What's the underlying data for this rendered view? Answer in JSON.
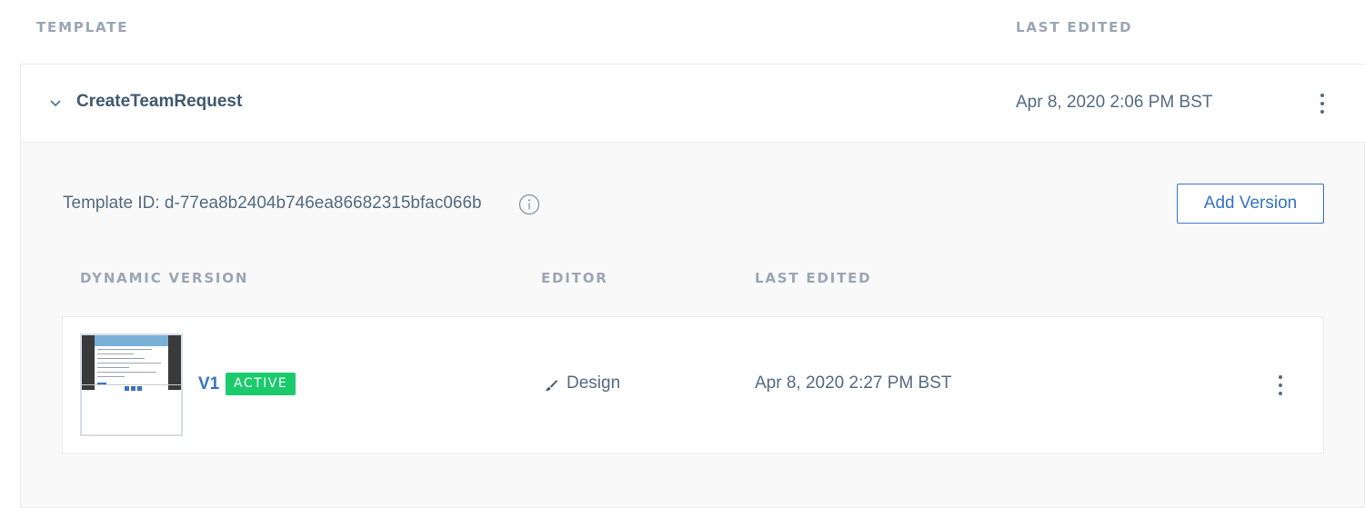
{
  "table_header": {
    "template": "TEMPLATE",
    "last_edited": "LAST EDITED"
  },
  "template": {
    "name": "CreateTeamRequest",
    "last_edited": "Apr 8, 2020 2:06 PM BST",
    "template_id_text": "Template ID: d-77ea8b2404b746ea86682315bfac066b",
    "add_version_label": "Add Version",
    "versions_header": {
      "dynamic_version": "DYNAMIC VERSION",
      "editor": "EDITOR",
      "last_edited": "LAST EDITED"
    },
    "versions": [
      {
        "name": "V1",
        "status": "ACTIVE",
        "editor": "Design",
        "last_edited": "Apr 8, 2020 2:27 PM BST"
      }
    ]
  },
  "icons": {
    "chevron": "chevron-down-icon",
    "info": "info-icon",
    "kebab": "more-vertical-icon",
    "editor": "brush-icon"
  },
  "colors": {
    "link_blue": "#3873c4",
    "active_green": "#1bca6b",
    "text_slate": "#546b81",
    "header_gray": "#9aa6b4"
  }
}
